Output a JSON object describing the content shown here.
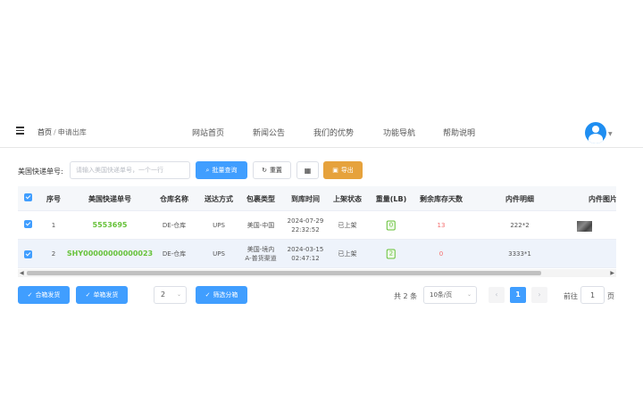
{
  "header": {
    "breadcrumb": {
      "home": "首页",
      "separator": "/",
      "current": "申请出库"
    },
    "nav": [
      "网站首页",
      "新闻公告",
      "我们的优势",
      "功能导航",
      "帮助说明"
    ],
    "menu_icon": "hamburger-icon",
    "avatar_icon": "user-avatar-icon"
  },
  "search": {
    "label": "美国快递单号:",
    "placeholder": "请输入美国快递单号，一个一行",
    "value": "",
    "buttons": {
      "batch_query": "批量查询",
      "reset": "重置",
      "grid": "",
      "export": "导出"
    }
  },
  "table": {
    "columns": [
      "序号",
      "美国快递单号",
      "仓库名称",
      "送达方式",
      "包裹类型",
      "到库时间",
      "上架状态",
      "重量(LB)",
      "剩余库存天数",
      "内件明细",
      "内件图片"
    ],
    "rows": [
      {
        "checked": true,
        "index": "1",
        "tracking": "5553695",
        "warehouse": "DE-仓库",
        "delivery": "UPS",
        "package_type_1": "美国-中国",
        "package_type_2": "",
        "arrival_date": "2024-07-29",
        "arrival_time": "22:32:52",
        "shelf_status": "已上架",
        "weight": "0",
        "days_left": "13",
        "items": "222*2",
        "has_image": true
      },
      {
        "checked": true,
        "index": "2",
        "tracking": "SHY00000000000023",
        "warehouse": "DE-仓库",
        "delivery": "UPS",
        "package_type_1": "美国-境内",
        "package_type_2": "A-普货渠道",
        "arrival_date": "2024-03-15",
        "arrival_time": "02:47:12",
        "shelf_status": "已上架",
        "weight": "2",
        "days_left": "0",
        "items": "3333*1",
        "has_image": false
      }
    ]
  },
  "footer": {
    "merge_ship": "合箱发货",
    "single_ship": "单箱发货",
    "select_value": "2",
    "filter_btn": "筛选分箱",
    "total_text": "共 2 条",
    "page_size": "10条/页",
    "prev": "‹",
    "current_page": "1",
    "next": "›",
    "goto_label": "前往",
    "goto_value": "1",
    "goto_unit": "页"
  },
  "colors": {
    "primary": "#409eff",
    "warning": "#e6a23c",
    "success": "#67c23a",
    "danger": "#f56c6c"
  }
}
